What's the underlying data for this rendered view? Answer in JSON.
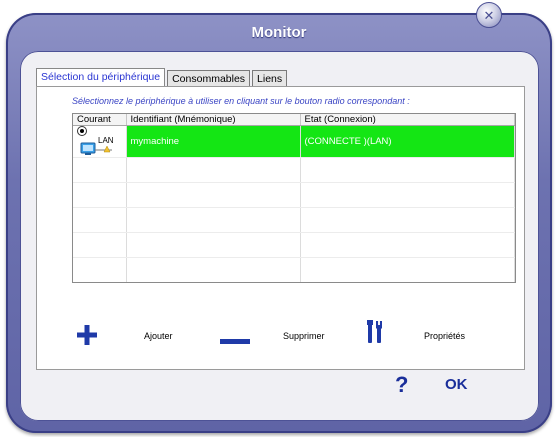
{
  "window": {
    "title": "Monitor"
  },
  "tabs": [
    {
      "label": "Sélection du périphérique",
      "active": true
    },
    {
      "label": "Consommables",
      "active": false
    },
    {
      "label": "Liens",
      "active": false
    }
  ],
  "hint": "Sélectionnez le périphérique à utiliser en cliquant sur le bouton radio correspondant :",
  "table": {
    "headers": [
      "Courant",
      "Identifiant (Mnémonique)",
      "Etat (Connexion)"
    ],
    "rows": [
      {
        "selected": true,
        "type_label": "LAN",
        "identifier": "mymachine",
        "status": "(CONNECTE )(LAN)"
      }
    ],
    "selection_color": "#14e614"
  },
  "actions": {
    "add_label": "Ajouter",
    "remove_label": "Supprimer",
    "properties_label": "Propriétés"
  },
  "buttons": {
    "help_label": "?",
    "ok_label": "OK"
  },
  "colors": {
    "frame": "#6d72b0",
    "accent": "#1a2e9a",
    "tab_active_text": "#2a35d2"
  }
}
